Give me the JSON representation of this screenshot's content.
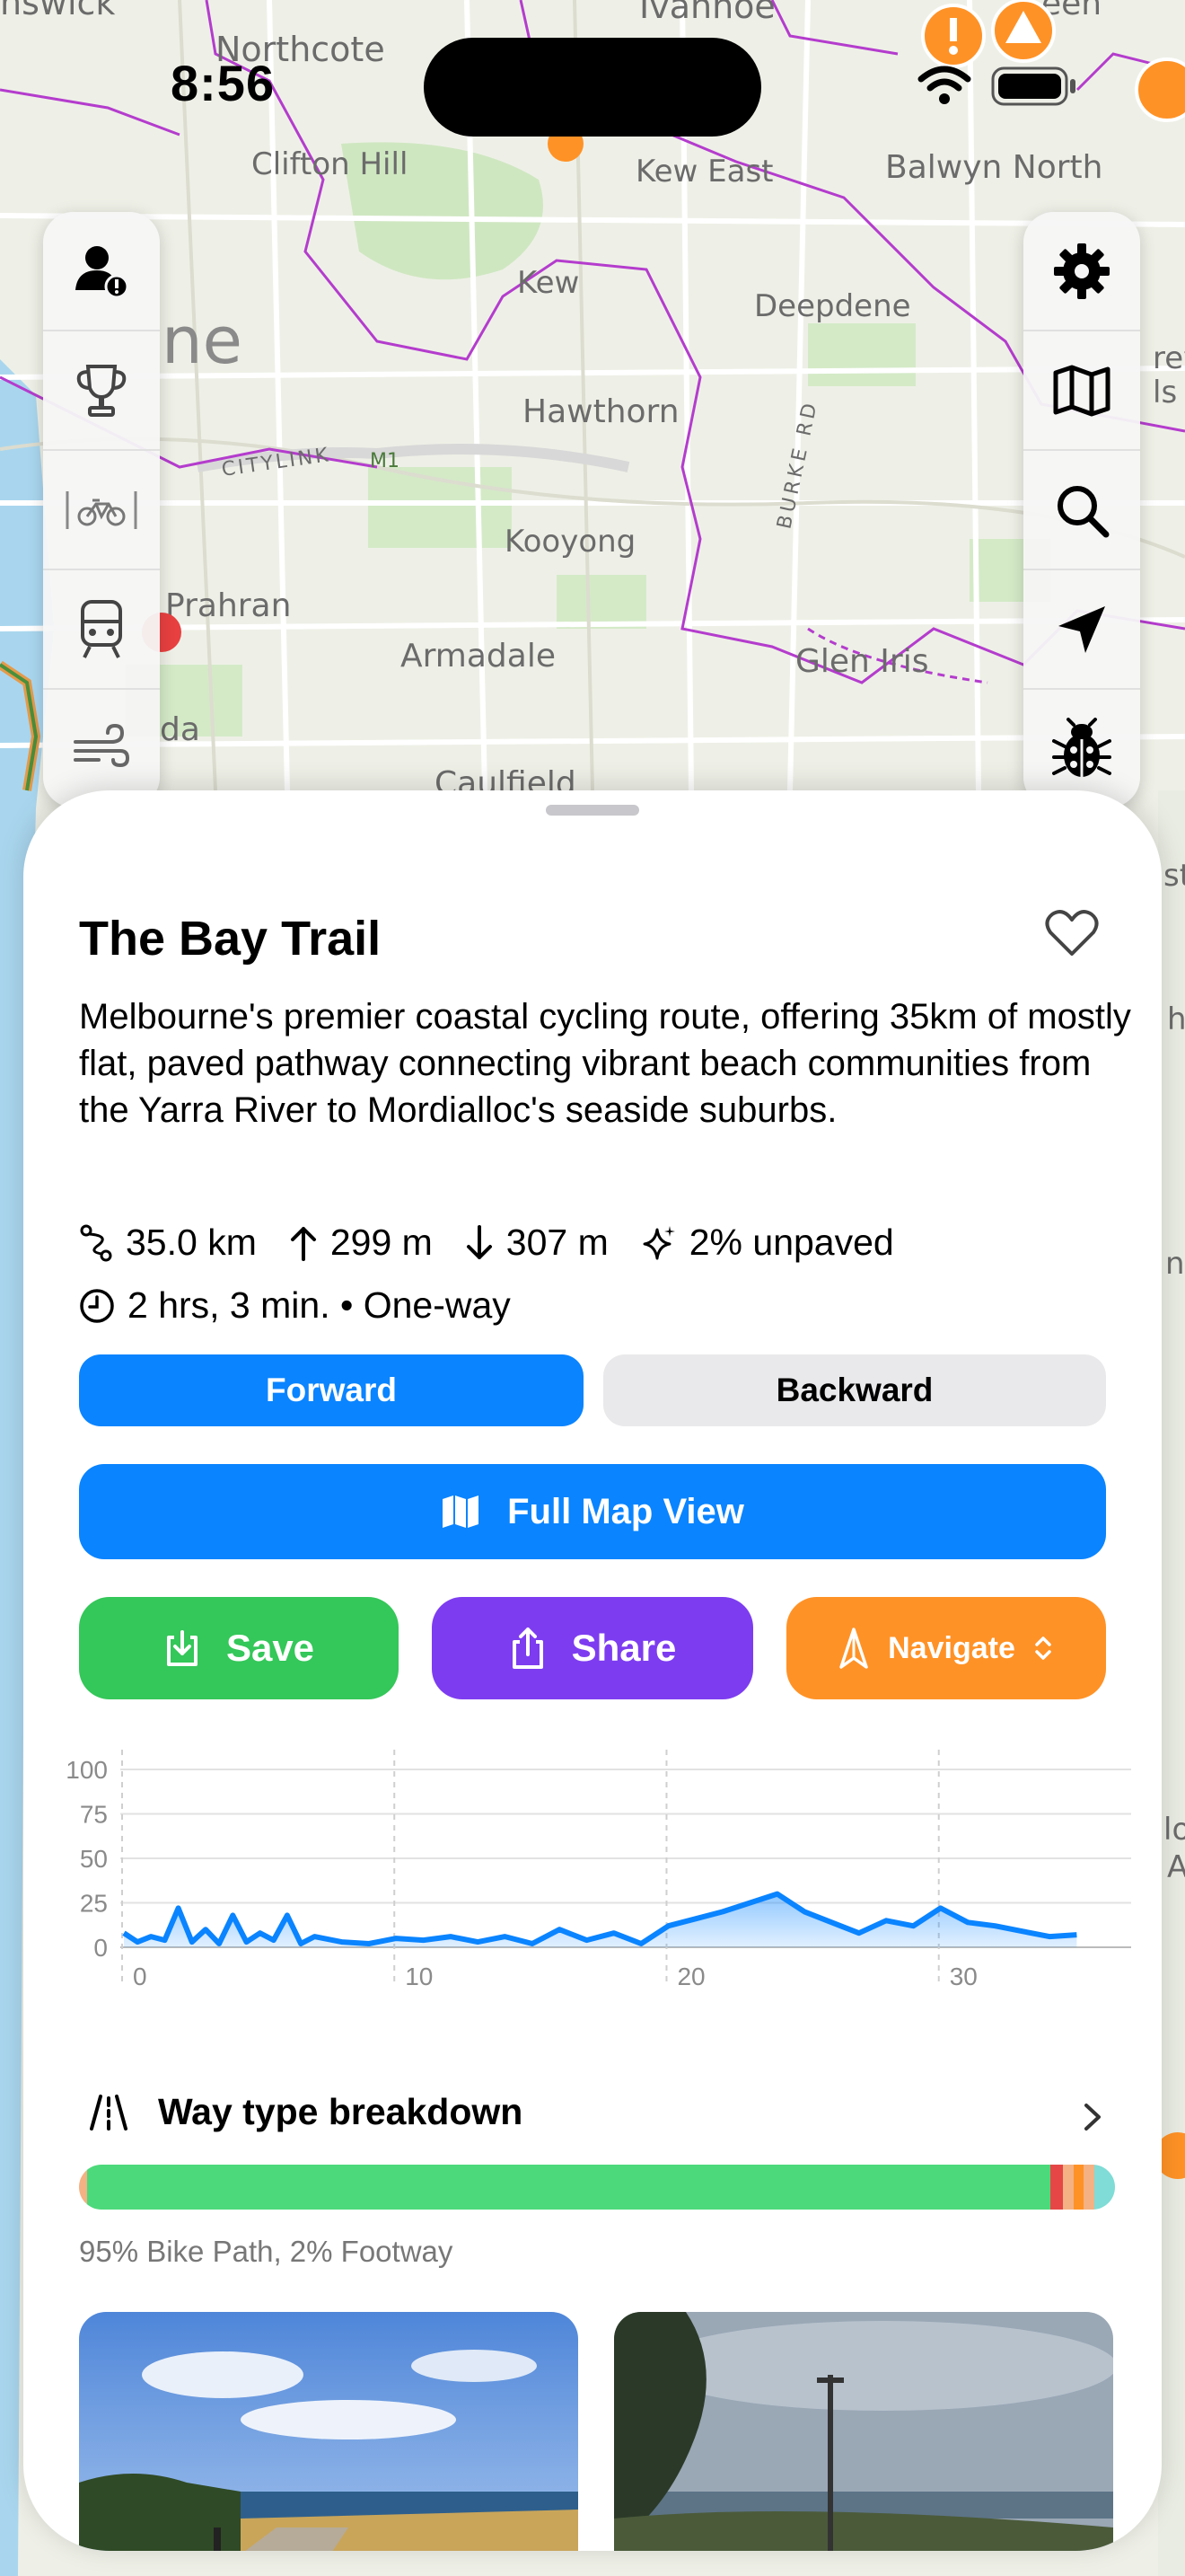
{
  "status": {
    "time": "8:56"
  },
  "map": {
    "labels": {
      "brunswick": "nswick",
      "northcote": "Northcote",
      "ivanhoe": "Ivanhoe",
      "ivanhoe_green": "een",
      "clifton_hill": "Clifton Hill",
      "kew_east": "Kew East",
      "balwyn_north": "Balwyn North",
      "kew": "Kew",
      "deepdene": "Deepdene",
      "melbourne": "ne",
      "hawthorn": "Hawthorn",
      "citylink": "CITYLINK",
      "m1": "M1",
      "burke_rd": "BURKE RD",
      "kooyong": "Kooyong",
      "prahran": "Prahran",
      "armadale": "Armadale",
      "glen_iris": "Glen Iris",
      "da": "da",
      "caulfield": "Caulfield",
      "right_edge_1": "rey",
      "right_edge_2": "ls",
      "right_edge_3": "st",
      "right_edge_4": "h",
      "right_edge_5": "n",
      "right_edge_6": "lo",
      "right_edge_7": "A"
    }
  },
  "left_rail": [
    "user-alert-icon",
    "trophy-icon",
    "bike-icon",
    "train-icon",
    "wind-icon"
  ],
  "right_rail": [
    "gear-icon",
    "map-icon",
    "search-icon",
    "location-arrow-icon",
    "bug-icon"
  ],
  "route": {
    "title": "The Bay Trail",
    "description": "Melbourne's premier coastal cycling route, offering 35km of mostly flat, paved pathway connecting vibrant beach communities from the Yarra River to Mordialloc's seaside suburbs.",
    "distance": "35.0 km",
    "ascent": "299 m",
    "descent": "307 m",
    "unpaved": "2% unpaved",
    "duration": "2 hrs, 3 min. • One-way",
    "favorited": false
  },
  "direction": {
    "forward": "Forward",
    "backward": "Backward",
    "selected": "Forward"
  },
  "buttons": {
    "full_map": "Full Map View",
    "save": "Save",
    "share": "Share",
    "navigate": "Navigate"
  },
  "colors": {
    "blue": "#0a84ff",
    "green": "#34c759",
    "purple": "#7d3cf0",
    "orange": "#ff9226",
    "path_green": "#4cd97b"
  },
  "chart_data": {
    "type": "area",
    "x_ticks": [
      "0",
      "10",
      "20",
      "30"
    ],
    "y_ticks": [
      "100",
      "75",
      "50",
      "25",
      "0"
    ],
    "ylim": [
      0,
      100
    ],
    "xlim": [
      0,
      37
    ],
    "grid": true,
    "series": [
      {
        "x": [
          0,
          0.5,
          1,
          1.5,
          2,
          2.5,
          3,
          3.5,
          4,
          4.5,
          5,
          5.5,
          6,
          6.5,
          7,
          8,
          9,
          10,
          11,
          12,
          13,
          14,
          15,
          16,
          17,
          18,
          19,
          20,
          21,
          22,
          23,
          24,
          25,
          26,
          27,
          28,
          29,
          30,
          31,
          32,
          33,
          34,
          35
        ],
        "y": [
          8,
          3,
          6,
          4,
          22,
          3,
          10,
          2,
          18,
          3,
          8,
          4,
          18,
          2,
          6,
          3,
          2,
          5,
          4,
          6,
          3,
          6,
          2,
          10,
          4,
          8,
          2,
          12,
          16,
          20,
          25,
          30,
          20,
          14,
          8,
          15,
          12,
          22,
          14,
          12,
          9,
          6,
          7
        ]
      }
    ]
  },
  "way_type": {
    "title": "Way type breakdown",
    "caption": "95% Bike Path, 2% Footway",
    "segments": [
      {
        "color": "#f4b183",
        "fraction": 0.008
      },
      {
        "color": "#4cd97b",
        "fraction": 0.93
      },
      {
        "color": "#e64646",
        "fraction": 0.012
      },
      {
        "color": "#f4b183",
        "fraction": 0.01
      },
      {
        "color": "#ff9226",
        "fraction": 0.01
      },
      {
        "color": "#f4b183",
        "fraction": 0.01
      },
      {
        "color": "#7fdcd6",
        "fraction": 0.02
      }
    ]
  }
}
